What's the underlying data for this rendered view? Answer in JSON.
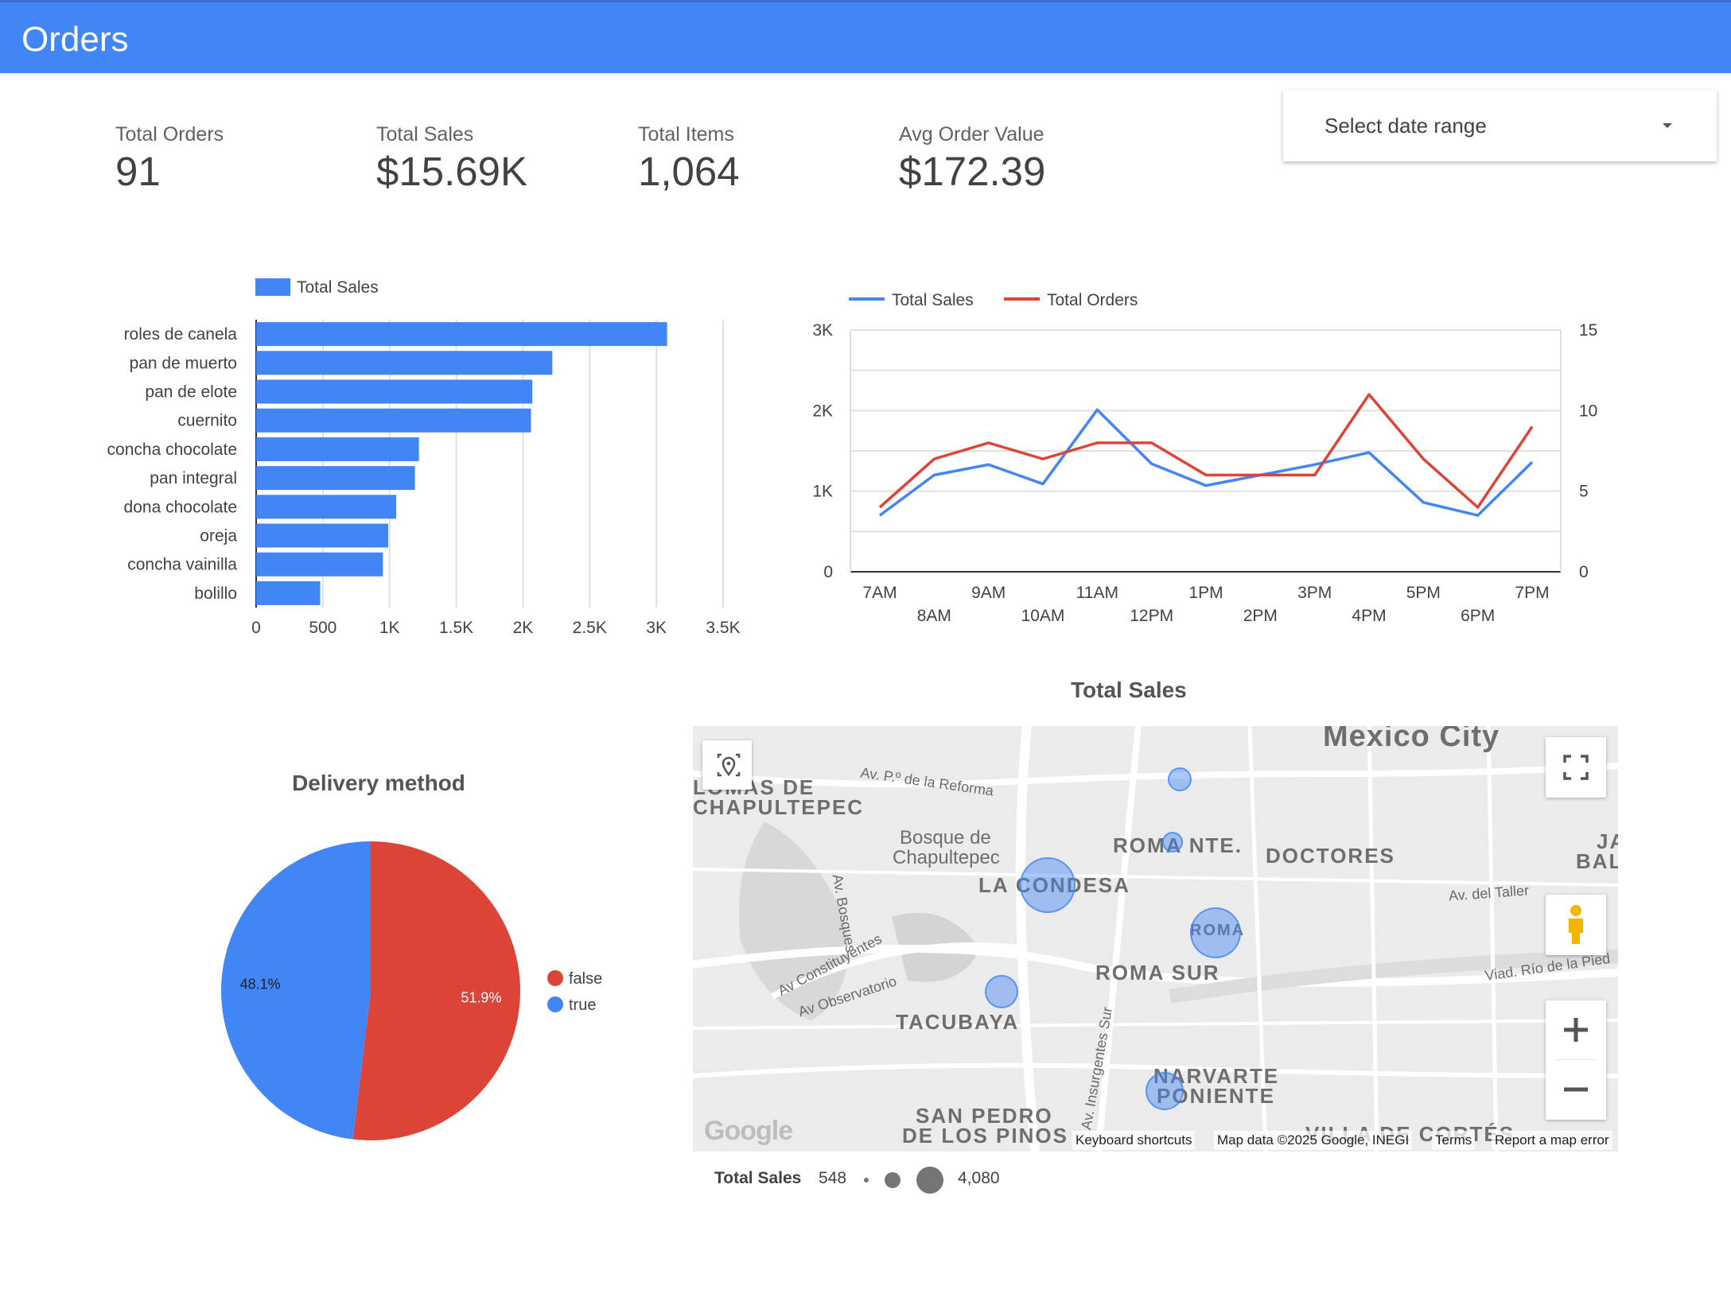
{
  "header": {
    "title": "Orders"
  },
  "kpis": [
    {
      "label": "Total Orders",
      "value": "91"
    },
    {
      "label": "Total Sales",
      "value": "$15.69K"
    },
    {
      "label": "Total Items",
      "value": "1,064"
    },
    {
      "label": "Avg Order Value",
      "value": "$172.39"
    }
  ],
  "date_range": {
    "placeholder": "Select date range"
  },
  "colors": {
    "header": "#4285f4",
    "blue": "#4285f4",
    "red": "#db4437",
    "map_bubble": "#4285f4"
  },
  "chart_data": [
    {
      "type": "bar",
      "orientation": "horizontal",
      "legend": "Total Sales",
      "categories": [
        "roles de canela",
        "pan de muerto",
        "pan de elote",
        "cuernito",
        "concha chocolate",
        "pan integral",
        "dona chocolate",
        "oreja",
        "concha vainilla",
        "bolillo"
      ],
      "values": [
        3080,
        2220,
        2070,
        2060,
        1220,
        1190,
        1050,
        990,
        950,
        480
      ],
      "xlim": [
        0,
        3500
      ],
      "xticks": [
        "0",
        "500",
        "1K",
        "1.5K",
        "2K",
        "2.5K",
        "3K",
        "3.5K"
      ],
      "grid": true
    },
    {
      "type": "line",
      "legend": [
        "Total Sales",
        "Total Orders"
      ],
      "x": [
        "7AM",
        "8AM",
        "9AM",
        "10AM",
        "11AM",
        "12PM",
        "1PM",
        "2PM",
        "3PM",
        "4PM",
        "5PM",
        "6PM",
        "7PM"
      ],
      "series": [
        {
          "name": "Total Sales",
          "axis": "left",
          "values": [
            700,
            1200,
            1330,
            1090,
            2010,
            1340,
            1070,
            1200,
            1330,
            1480,
            860,
            700,
            1360
          ]
        },
        {
          "name": "Total Orders",
          "axis": "right",
          "values": [
            4,
            7,
            8,
            7,
            8,
            8,
            6,
            6,
            6,
            11,
            7,
            4,
            9
          ]
        }
      ],
      "y_left": {
        "lim": [
          0,
          3000
        ],
        "ticks": [
          "0",
          "1K",
          "2K",
          "3K"
        ]
      },
      "y_right": {
        "lim": [
          0,
          15
        ],
        "ticks": [
          "0",
          "5",
          "10",
          "15"
        ]
      },
      "grid": true
    },
    {
      "type": "pie",
      "title": "Delivery method",
      "slices": [
        {
          "label": "false",
          "value": 51.9,
          "display": "51.9%"
        },
        {
          "label": "true",
          "value": 48.1,
          "display": "48.1%"
        }
      ],
      "legend_position": "right"
    }
  ],
  "map": {
    "title": "Total Sales",
    "labels": [
      "Mexico City",
      "LOMAS DE",
      "CHAPULTEPEC",
      "Bosque de",
      "Chapultepec",
      "LA CONDESA",
      "ROMA NTE.",
      "DOCTORES",
      "ROMA",
      "ROMA SUR",
      "TACUBAYA",
      "NARVARTE",
      "PONIENTE",
      "SAN PEDRO",
      "DE LOS PINOS",
      "VILLA DE CORTÉS",
      "JA",
      "BAL"
    ],
    "streets": [
      "Av. P.º de la Reforma",
      "Av. Bosques",
      "Av Constituyentes",
      "Av Observatorio",
      "Av. del Taller",
      "Viad. Río de la Pied",
      "Av. Insurgentes Sur"
    ],
    "footer": {
      "brand": "Google",
      "shortcuts": "Keyboard shortcuts",
      "data": "Map data ©2025 Google, INEGI",
      "terms": "Terms",
      "report": "Report a map error"
    },
    "size_legend": {
      "label": "Total Sales",
      "min": "548",
      "max": "4,080"
    }
  }
}
